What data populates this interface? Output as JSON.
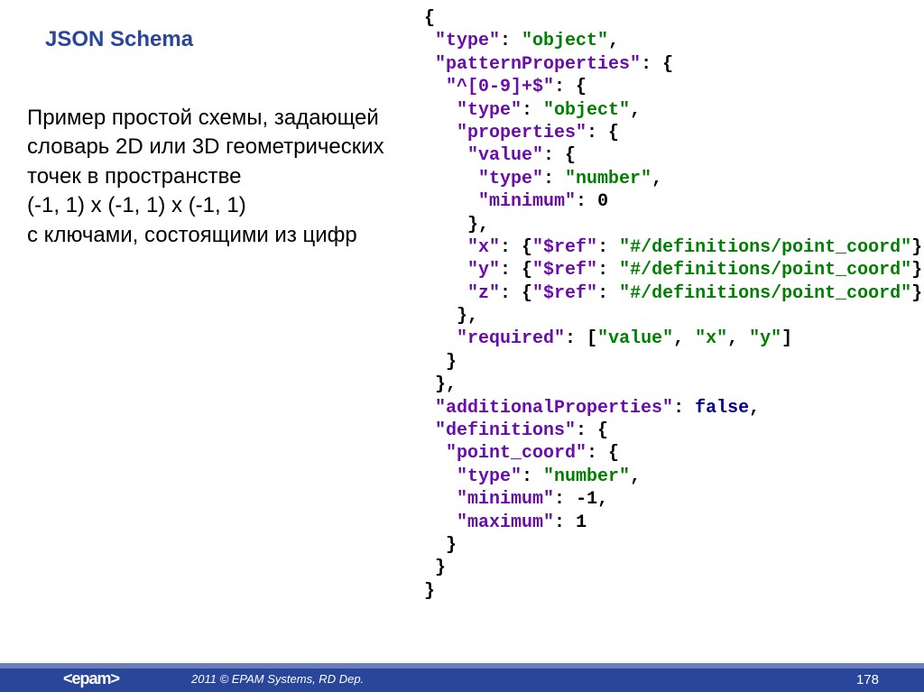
{
  "heading": "JSON Schema",
  "description": "Пример простой схемы, задающей словарь 2D или 3D геометрических точек в пространстве\n(-1, 1) x (-1, 1) x (-1, 1)\nс ключами, состоящими из цифр",
  "code": {
    "l01_p1": "{",
    "l02_k": "\"type\"",
    "l02_s": "\"object\"",
    "l03_k": "\"patternProperties\"",
    "l04_k": "\"^[0-9]+$\"",
    "l05_k": "\"type\"",
    "l05_s": "\"object\"",
    "l06_k": "\"properties\"",
    "l07_k": "\"value\"",
    "l08_k": "\"type\"",
    "l08_s": "\"number\"",
    "l09_k": "\"minimum\"",
    "l09_n": "0",
    "l11_k": "\"x\"",
    "l11_rk": "\"$ref\"",
    "l11_rs": "\"#/definitions/point_coord\"",
    "l12_k": "\"y\"",
    "l12_rk": "\"$ref\"",
    "l12_rs": "\"#/definitions/point_coord\"",
    "l13_k": "\"z\"",
    "l13_rk": "\"$ref\"",
    "l13_rs": "\"#/definitions/point_coord\"",
    "l15_k": "\"required\"",
    "l15_s1": "\"value\"",
    "l15_s2": "\"x\"",
    "l15_s3": "\"y\"",
    "l18_k": "\"additionalProperties\"",
    "l18_b": "false",
    "l19_k": "\"definitions\"",
    "l20_k": "\"point_coord\"",
    "l21_k": "\"type\"",
    "l21_s": "\"number\"",
    "l22_k": "\"minimum\"",
    "l22_n": "-1",
    "l23_k": "\"maximum\"",
    "l23_n": "1"
  },
  "footer": {
    "logo": "<epam>",
    "copyright": "2011 © EPAM Systems, RD Dep.",
    "page": "178"
  }
}
